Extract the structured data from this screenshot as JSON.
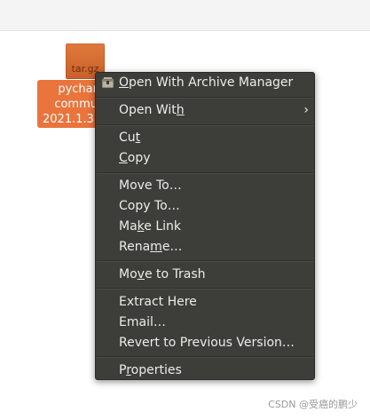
{
  "desktop": {
    "file": {
      "icon_text": "tar.gz",
      "label_lines": [
        "pychar",
        "commu",
        "2021.1.3."
      ]
    }
  },
  "context_menu": {
    "items": [
      {
        "before": "",
        "mnemonic": "O",
        "after": "pen With Archive Manager"
      },
      {
        "before": "Open Wit",
        "mnemonic": "h",
        "after": "",
        "submenu_arrow": "›"
      },
      {
        "before": "Cu",
        "mnemonic": "t",
        "after": ""
      },
      {
        "before": "",
        "mnemonic": "C",
        "after": "opy"
      },
      {
        "before": "Move To…",
        "mnemonic": "",
        "after": ""
      },
      {
        "before": "Copy To…",
        "mnemonic": "",
        "after": ""
      },
      {
        "before": "Ma",
        "mnemonic": "k",
        "after": "e Link"
      },
      {
        "before": "Rena",
        "mnemonic": "m",
        "after": "e…"
      },
      {
        "before": "Mo",
        "mnemonic": "v",
        "after": "e to Trash"
      },
      {
        "before": "Extract Here",
        "mnemonic": "",
        "after": ""
      },
      {
        "before": "Email…",
        "mnemonic": "",
        "after": ""
      },
      {
        "before": "Revert to Previous Version…",
        "mnemonic": "",
        "after": ""
      },
      {
        "before": "P",
        "mnemonic": "r",
        "after": "operties"
      }
    ],
    "open_with_archive_icon": "archive-manager-icon"
  },
  "watermark": "CSDN @受癌的鹏少",
  "colors": {
    "menu_bg": "#3d3d3a",
    "menu_text": "#ececec",
    "file_label_bg": "#e9743c",
    "file_icon_bg": "#d96a30"
  }
}
